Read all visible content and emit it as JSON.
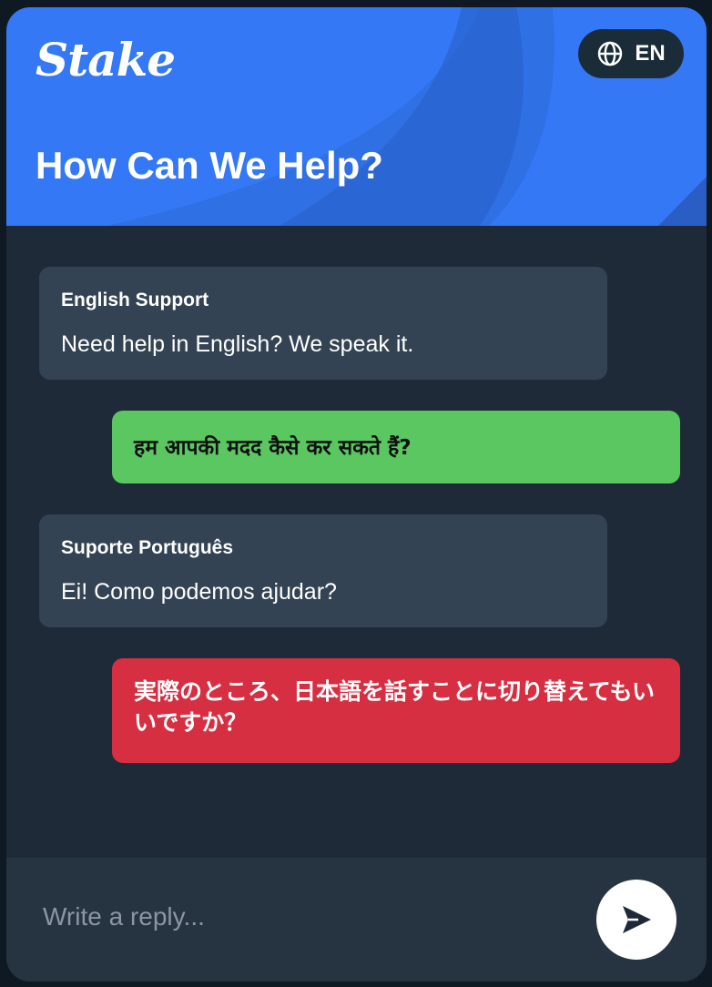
{
  "header": {
    "logo_text": "Stake",
    "title": "How Can We Help?",
    "language_code": "EN"
  },
  "messages": [
    {
      "direction": "incoming",
      "sender": "English Support",
      "text": "Need help in English? We speak it."
    },
    {
      "direction": "outgoing",
      "text": "हम आपकी मदद कैसे कर सकते हैं?",
      "color": "#5bc761"
    },
    {
      "direction": "incoming",
      "sender": "Suporte Português",
      "text": "Ei! Como podemos ajudar?"
    },
    {
      "direction": "outgoing",
      "text": "実際のところ、日本語を話すことに切り替えてもいいですか？",
      "color": "#d62f42"
    }
  ],
  "composer": {
    "placeholder": "Write a reply...",
    "send_icon": "send-icon"
  },
  "colors": {
    "brand": "#3478f6",
    "panel": "#1e2a37",
    "bubble_incoming": "#344353"
  },
  "icons": {
    "language": "globe-icon",
    "send": "send-icon"
  }
}
